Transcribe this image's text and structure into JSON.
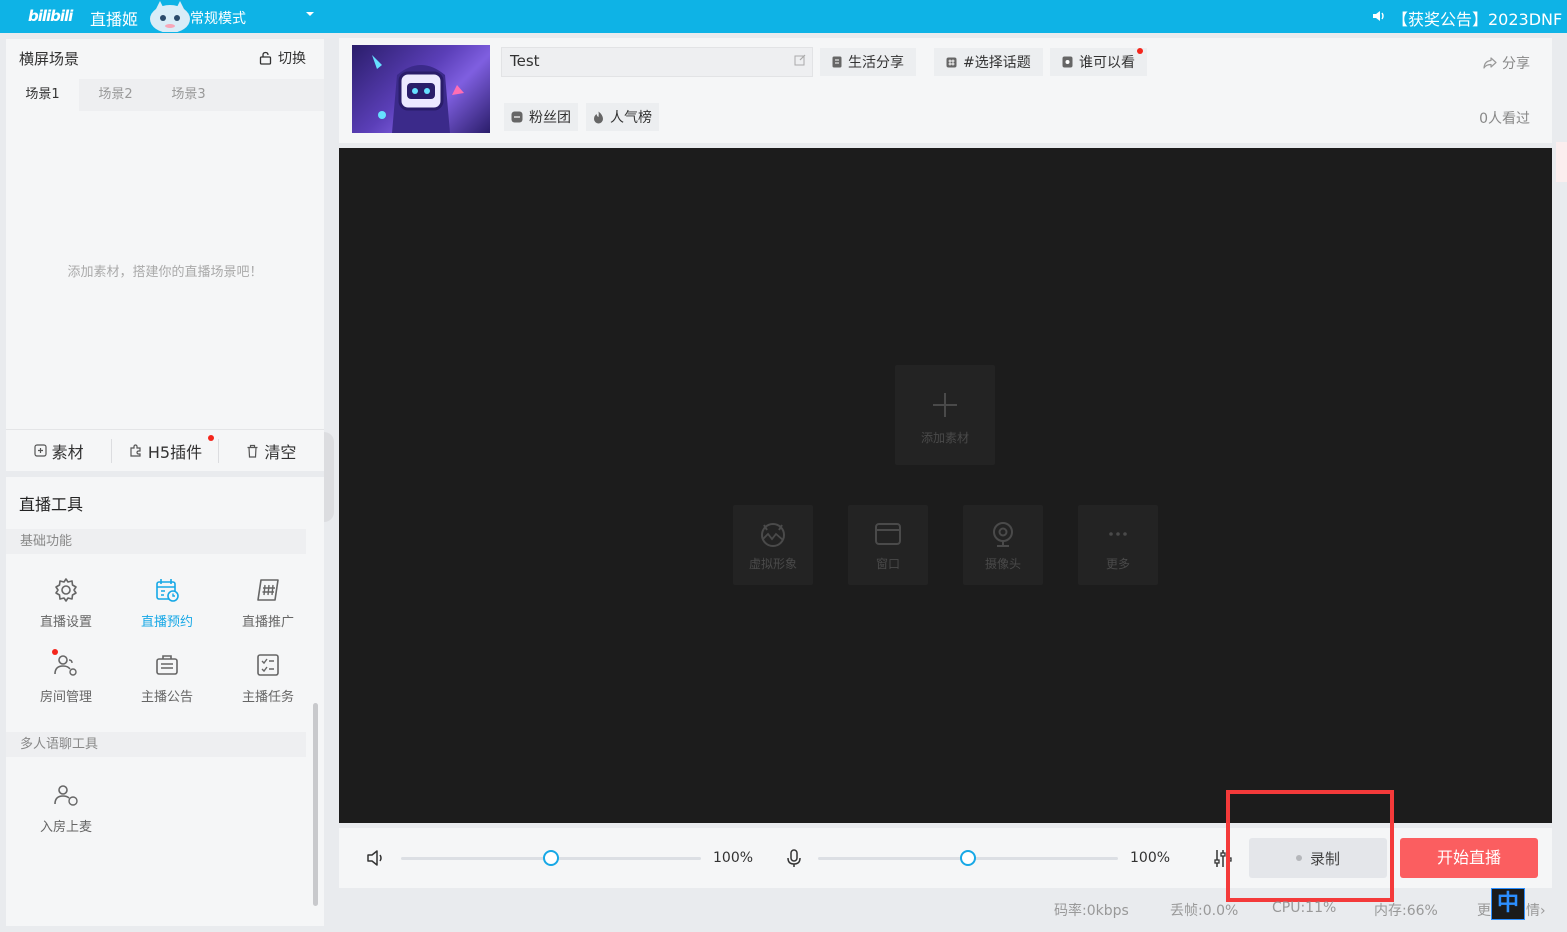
{
  "titlebar": {
    "logo": "bilibili",
    "app_name": "直播姬",
    "mode": "常规模式",
    "announcement": "【获奖公告】2023DNF"
  },
  "scenes": {
    "title": "横屏场景",
    "switch_label": "切换",
    "tabs": [
      "场景1",
      "场景2",
      "场景3"
    ],
    "active_tab": "场景1",
    "empty_hint": "添加素材，搭建你的直播场景吧！",
    "actions": {
      "material": "素材",
      "h5_plugin": "H5插件",
      "clear": "清空"
    }
  },
  "tools": {
    "title": "直播工具",
    "basic_label": "基础功能",
    "basic_items": [
      "直播设置",
      "直播预约",
      "直播推广",
      "房间管理",
      "主播公告",
      "主播任务"
    ],
    "active_item": "直播预约",
    "multi_label": "多人语聊工具",
    "multi_items": [
      "入房上麦"
    ]
  },
  "room": {
    "title_value": "Test",
    "chips": {
      "life_share": "生活分享",
      "topic": "#选择话题",
      "visibility": "谁可以看",
      "fan_club": "粉丝团",
      "popularity": "人气榜"
    },
    "share": "分享",
    "viewers": "0人看过"
  },
  "preview": {
    "add_material": "添加素材",
    "sources": [
      "虚拟形象",
      "窗口",
      "摄像头",
      "更多"
    ]
  },
  "controls": {
    "speaker_volume": "100%",
    "mic_volume": "100%",
    "speaker_level": 0.5,
    "mic_level": 0.5,
    "record": "录制",
    "start_live": "开始直播"
  },
  "status": {
    "bitrate": "码率:0kbps",
    "dropped": "丢帧:0.0%",
    "cpu": "CPU:11%",
    "memory": "内存:66%",
    "more": "更",
    "more_tail": "情›"
  },
  "ime": "中",
  "colors": {
    "brand": "#0eb3e6",
    "accent": "#17a8e6",
    "start_button": "#fb5e60",
    "highlight": "#f43a3a"
  }
}
